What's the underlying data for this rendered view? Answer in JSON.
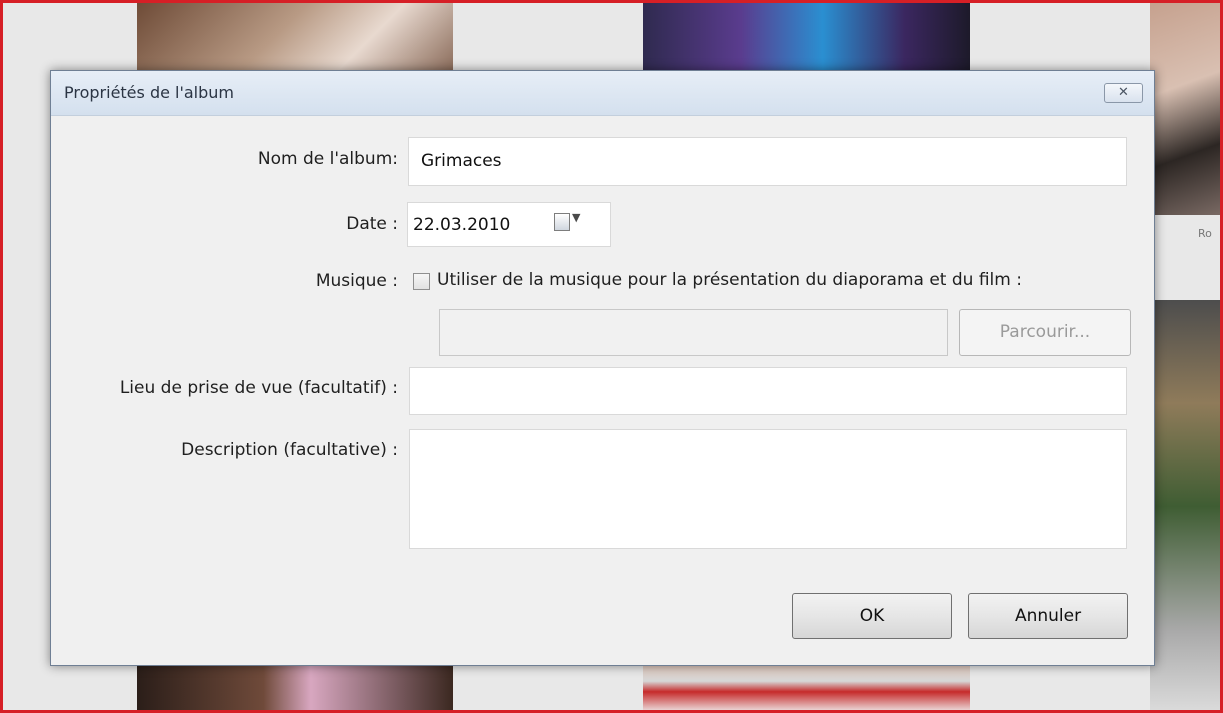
{
  "background": {
    "side_caption": "Ro"
  },
  "dialog": {
    "title": "Propriétés de l'album",
    "close_glyph": "✕",
    "fields": {
      "album_name": {
        "label": "Nom de l'album:",
        "value": "Grimaces"
      },
      "date": {
        "label": "Date :",
        "value": "22.03.2010",
        "icon": "calendar-icon"
      },
      "music": {
        "label": "Musique :",
        "checkbox_label": "Utiliser de la musique pour la présentation du diaporama et du film :",
        "checked": false,
        "path_value": "",
        "browse_label": "Parcourir..."
      },
      "location": {
        "label": "Lieu de prise de vue (facultatif) :",
        "value": ""
      },
      "description": {
        "label": "Description (facultative) :",
        "value": ""
      }
    },
    "buttons": {
      "ok_label": "OK",
      "cancel_label": "Annuler"
    }
  },
  "colors": {
    "frame": "#d61f26",
    "titlebar": "#dce6f2",
    "dialog_bg": "#f0f0f0"
  }
}
